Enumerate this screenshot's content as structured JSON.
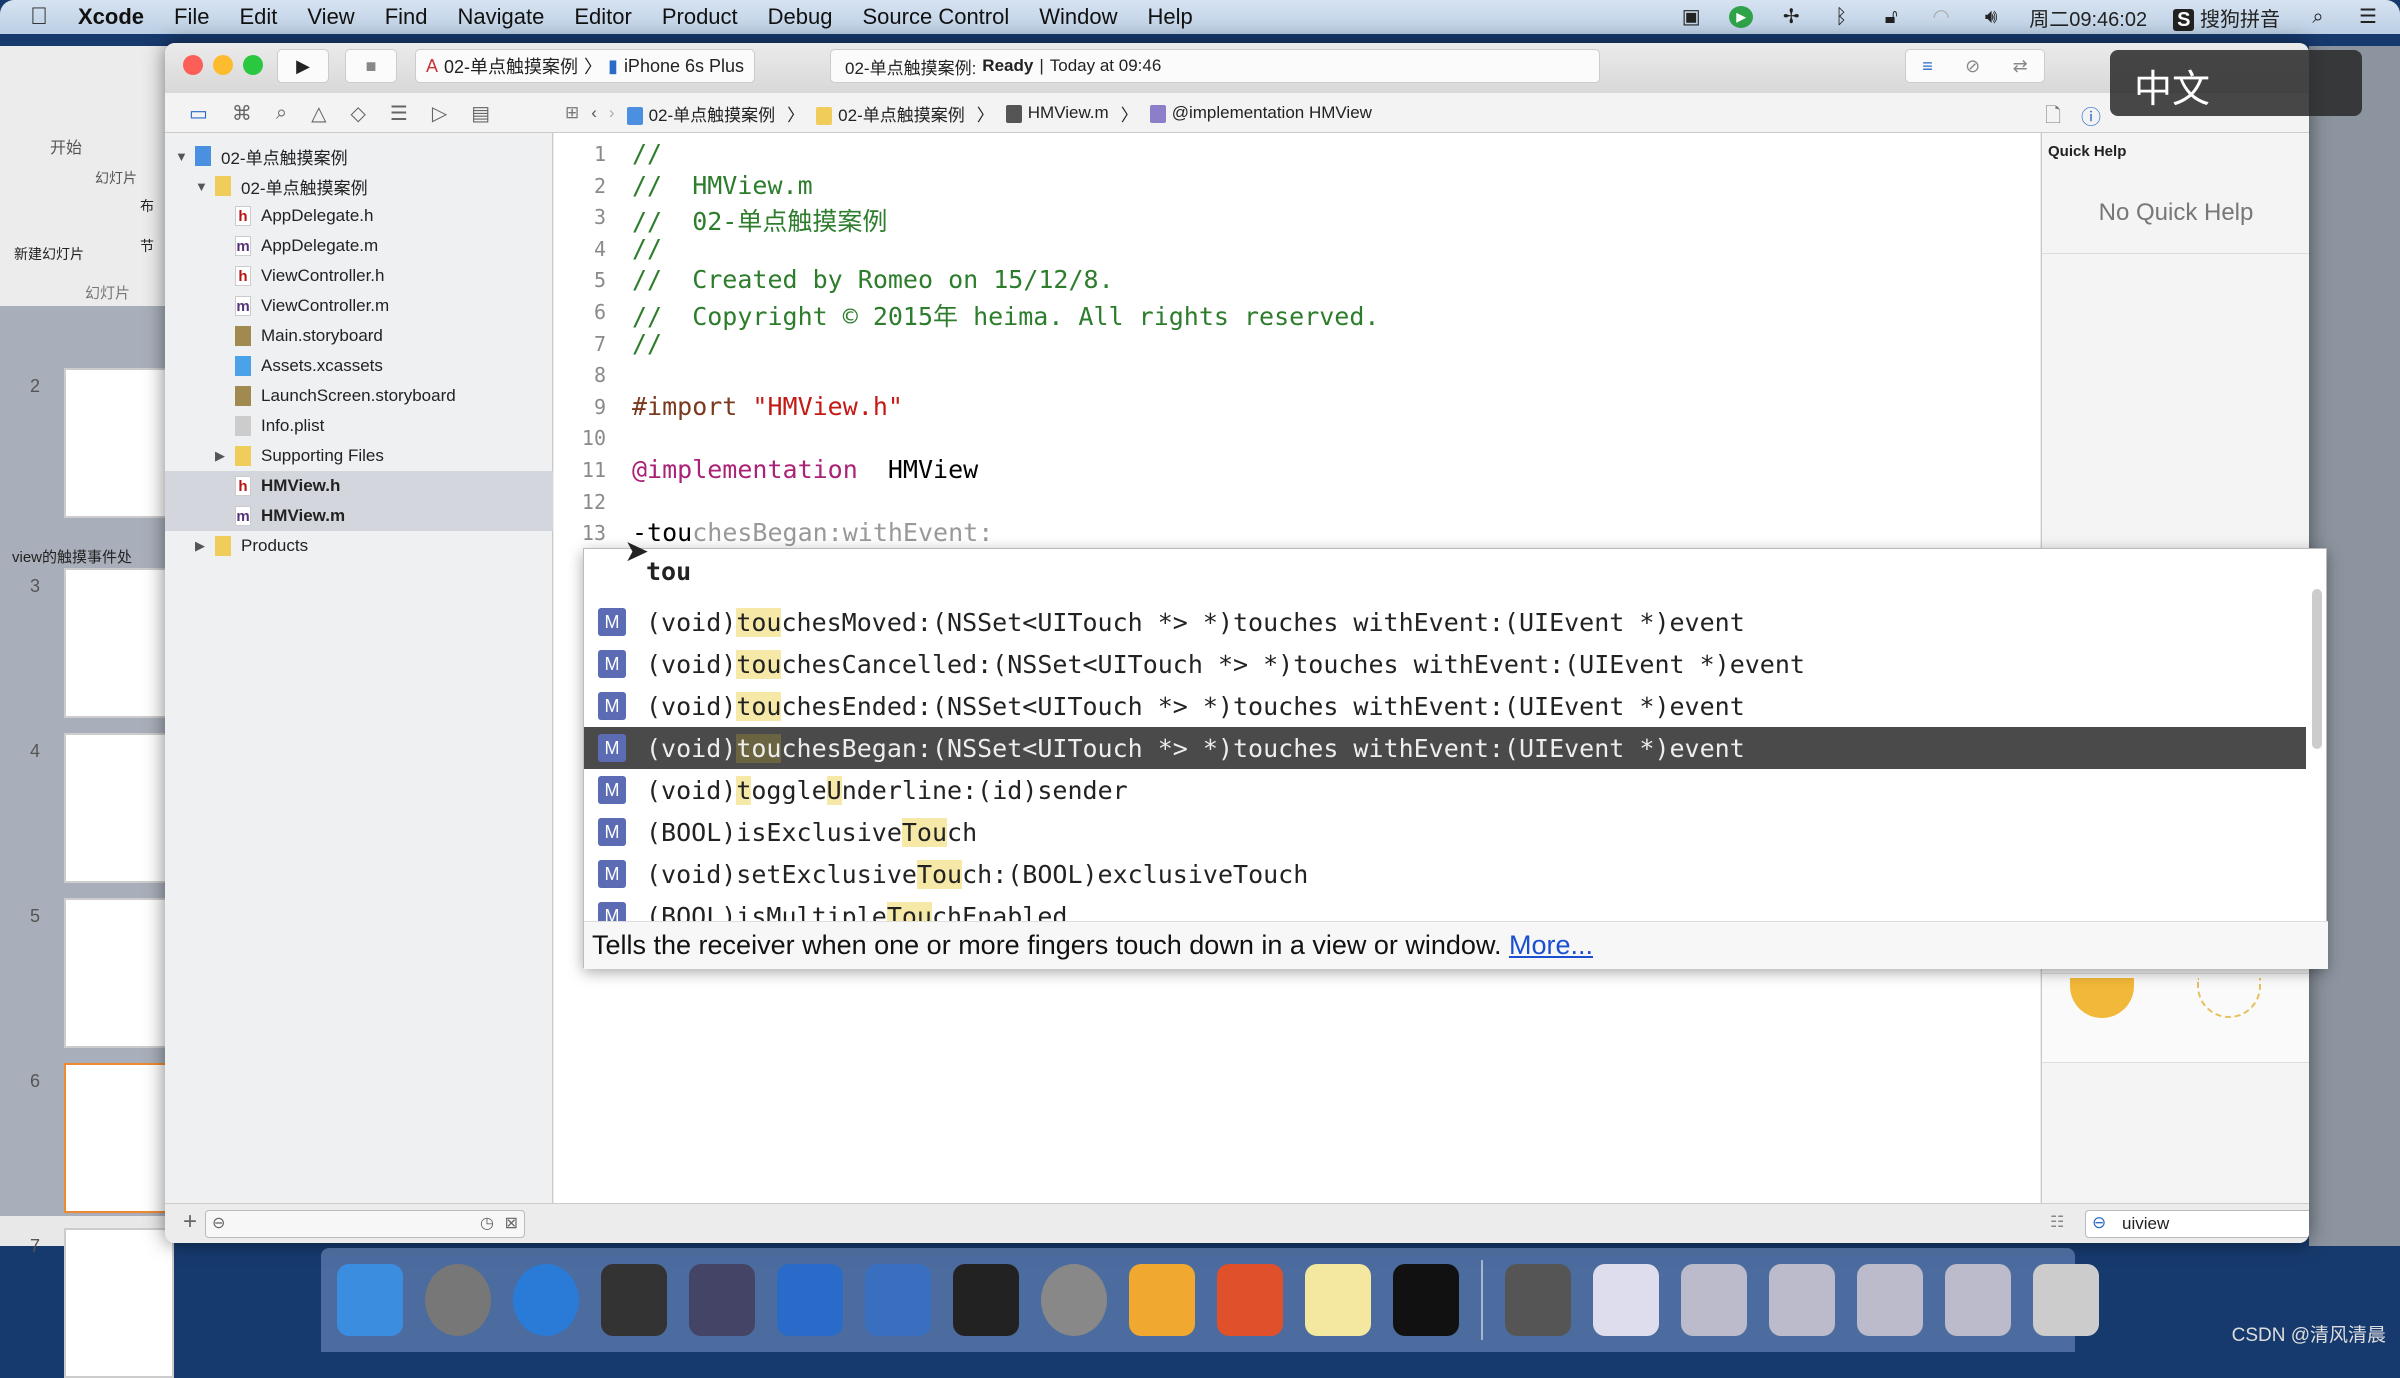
{
  "menubar": {
    "app": "Xcode",
    "items": [
      "File",
      "Edit",
      "View",
      "Find",
      "Navigate",
      "Editor",
      "Product",
      "Debug",
      "Source Control",
      "Window",
      "Help"
    ],
    "clock": "周二09:46:02",
    "ime_name": "搜狗拼音"
  },
  "ppt": {
    "tab_home": "开始",
    "group_slides": "幻灯片",
    "new_slide": "新建幻灯片",
    "layout": "布",
    "section": "节",
    "slides_tab": "幻灯片",
    "section_label": "view的触摸事件处",
    "slide_numbers": [
      "2",
      "3",
      "4",
      "5",
      "6",
      "7"
    ]
  },
  "toolbar": {
    "scheme": "02-单点触摸案例",
    "device": "iPhone 6s Plus",
    "status_project": "02-单点触摸案例:",
    "status_state": "Ready",
    "status_time": "Today at 09:46"
  },
  "jumpbar": {
    "crumbs": [
      "02-单点触摸案例",
      "02-单点触摸案例",
      "HMView.m",
      "@implementation HMView"
    ]
  },
  "navigator": {
    "items": [
      {
        "label": "02-单点触摸案例",
        "type": "project",
        "level": 0
      },
      {
        "label": "02-单点触摸案例",
        "type": "folder",
        "level": 1
      },
      {
        "label": "AppDelegate.h",
        "type": "h",
        "level": 2
      },
      {
        "label": "AppDelegate.m",
        "type": "m",
        "level": 2
      },
      {
        "label": "ViewController.h",
        "type": "h",
        "level": 2
      },
      {
        "label": "ViewController.m",
        "type": "m",
        "level": 2
      },
      {
        "label": "Main.storyboard",
        "type": "storyboard",
        "level": 2
      },
      {
        "label": "Assets.xcassets",
        "type": "assets",
        "level": 2
      },
      {
        "label": "LaunchScreen.storyboard",
        "type": "storyboard",
        "level": 2
      },
      {
        "label": "Info.plist",
        "type": "plist",
        "level": 2
      },
      {
        "label": "Supporting Files",
        "type": "folder-closed",
        "level": 2
      },
      {
        "label": "HMView.h",
        "type": "h",
        "level": 2,
        "selected": true
      },
      {
        "label": "HMView.m",
        "type": "m",
        "level": 2,
        "selected": true
      },
      {
        "label": "Products",
        "type": "folder-closed",
        "level": 1
      }
    ]
  },
  "editor": {
    "lines": [
      {
        "n": "1",
        "parts": [
          [
            "cm",
            "//"
          ]
        ]
      },
      {
        "n": "2",
        "parts": [
          [
            "cm",
            "//  HMView.m"
          ]
        ]
      },
      {
        "n": "3",
        "parts": [
          [
            "cm",
            "//  02-单点触摸案例"
          ]
        ]
      },
      {
        "n": "4",
        "parts": [
          [
            "cm",
            "//"
          ]
        ]
      },
      {
        "n": "5",
        "parts": [
          [
            "cm",
            "//  Created by Romeo on 15/12/8."
          ]
        ]
      },
      {
        "n": "6",
        "parts": [
          [
            "cm",
            "//  Copyright © 2015年 heima. All rights reserved."
          ]
        ]
      },
      {
        "n": "7",
        "parts": [
          [
            "cm",
            "//"
          ]
        ]
      },
      {
        "n": "8",
        "parts": []
      },
      {
        "n": "9",
        "parts": [
          [
            "pp",
            "#import "
          ],
          [
            "str",
            "\"HMView.h\""
          ]
        ]
      },
      {
        "n": "10",
        "parts": []
      },
      {
        "n": "11",
        "parts": [
          [
            "kw",
            "@implementation"
          ],
          [
            "",
            "  HMView"
          ]
        ]
      },
      {
        "n": "12",
        "parts": []
      },
      {
        "n": "13",
        "parts": [
          [
            "",
            "-tou"
          ],
          [
            "ghost",
            "chesBegan:withEvent:"
          ]
        ]
      }
    ]
  },
  "completion": {
    "typed": "tou",
    "items": [
      {
        "parts": [
          [
            "",
            "(void)"
          ],
          [
            "hl",
            "tou"
          ],
          [
            "",
            "chesMoved:(NSSet<UITouch *> *)touches withEvent:(UIEvent *)event"
          ]
        ]
      },
      {
        "parts": [
          [
            "",
            "(void)"
          ],
          [
            "hl",
            "tou"
          ],
          [
            "",
            "chesCancelled:(NSSet<UITouch *> *)touches withEvent:(UIEvent *)event"
          ]
        ]
      },
      {
        "parts": [
          [
            "",
            "(void)"
          ],
          [
            "hl",
            "tou"
          ],
          [
            "",
            "chesEnded:(NSSet<UITouch *> *)touches withEvent:(UIEvent *)event"
          ]
        ]
      },
      {
        "parts": [
          [
            "",
            "(void)"
          ],
          [
            "hl",
            "tou"
          ],
          [
            "",
            "chesBegan:(NSSet<UITouch *> *)touches withEvent:(UIEvent *)event"
          ]
        ],
        "selected": true
      },
      {
        "parts": [
          [
            "",
            "(void)"
          ],
          [
            "hl",
            "t"
          ],
          [
            "",
            "ogg"
          ],
          [
            "",
            "le"
          ],
          [
            "hl",
            "U"
          ],
          [
            "",
            "nderline:(id)sender"
          ]
        ]
      },
      {
        "parts": [
          [
            "",
            "(BOOL)isExclusive"
          ],
          [
            "hl",
            "Tou"
          ],
          [
            "",
            "ch"
          ]
        ]
      },
      {
        "parts": [
          [
            "",
            "(void)setExclusive"
          ],
          [
            "hl",
            "Tou"
          ],
          [
            "",
            "ch:(BOOL)exclusiveTouch"
          ]
        ]
      },
      {
        "parts": [
          [
            "",
            "(BOOL)isMultiple"
          ],
          [
            "hl",
            "Tou"
          ],
          [
            "",
            "chEnabled"
          ]
        ]
      }
    ],
    "badge": "M",
    "description": "Tells the receiver when one or more fingers touch down in a view or window.",
    "more_link": "More..."
  },
  "utility": {
    "title": "Quick Help",
    "empty": "No Quick Help",
    "search_value": "uiview"
  },
  "ime_overlay": "中文",
  "dock": {
    "icons": [
      [
        "finder",
        "#3b8de0"
      ],
      [
        "launchpad",
        "#777"
      ],
      [
        "safari",
        "#2a7ad8"
      ],
      [
        "mouse-app",
        "#333"
      ],
      [
        "photo-slideshow",
        "#446"
      ],
      [
        "xcode",
        "#2a6bc9"
      ],
      [
        "instruments",
        "#3a6fc0"
      ],
      [
        "terminal",
        "#222"
      ],
      [
        "system-preferences",
        "#888"
      ],
      [
        "sketch",
        "#f0a830"
      ],
      [
        "wps-presentation",
        "#e0502a"
      ],
      [
        "notes",
        "#f4e7a0"
      ],
      [
        "exec-terminal",
        "#111"
      ],
      [
        "sep",
        ""
      ],
      [
        "quicktime",
        "#555"
      ],
      [
        "preview-window",
        "#dde"
      ],
      [
        "preview-window",
        "#bbc"
      ],
      [
        "preview-window",
        "#bbc"
      ],
      [
        "preview-window",
        "#bbc"
      ],
      [
        "preview-window",
        "#bbc"
      ],
      [
        "trash",
        "#ccc"
      ]
    ]
  },
  "watermark": "CSDN @清风清晨",
  "colors": {
    "menubar": "#c9d9ea",
    "desktop": "#173a6e",
    "selection": "#4a4a4a",
    "match_highlight": "#f6e9a8",
    "badge": "#5b6cb5"
  }
}
